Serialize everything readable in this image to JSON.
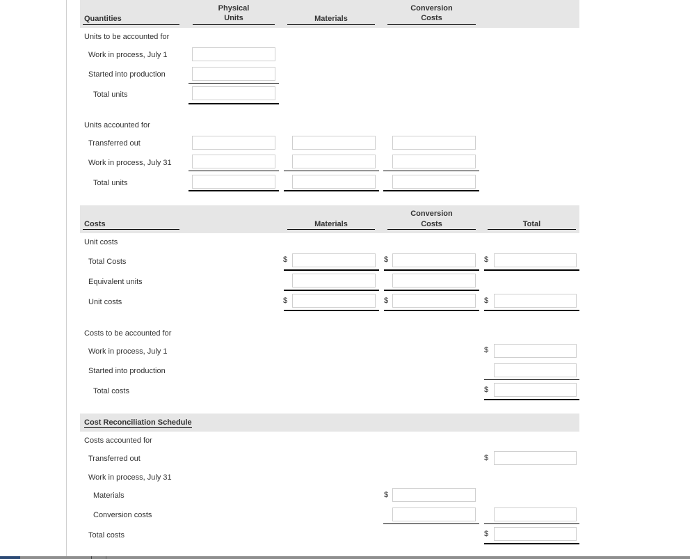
{
  "quantities": {
    "header": {
      "title": "Quantities",
      "col_physical": "Physical\nUnits",
      "col_physical_l1": "Physical",
      "col_physical_l2": "Units",
      "col_materials": "Materials",
      "col_conversion_l1": "Conversion",
      "col_conversion_l2": "Costs"
    },
    "to_be_accounted": {
      "label": "Units to be accounted for",
      "rows": [
        {
          "label": "Work in process, July 1",
          "physical": ""
        },
        {
          "label": "Started into production",
          "physical": ""
        },
        {
          "label": "Total units",
          "physical": ""
        }
      ]
    },
    "accounted": {
      "label": "Units accounted for",
      "rows": [
        {
          "label": "Transferred out",
          "physical": "",
          "materials": "",
          "conversion": ""
        },
        {
          "label": "Work in process, July 31",
          "physical": "",
          "materials": "",
          "conversion": ""
        },
        {
          "label": "Total units",
          "physical": "",
          "materials": "",
          "conversion": ""
        }
      ]
    }
  },
  "costs": {
    "header": {
      "title": "Costs",
      "col_materials": "Materials",
      "col_conversion_l1": "Conversion",
      "col_conversion_l2": "Costs",
      "col_total": "Total"
    },
    "unit_costs": {
      "label": "Unit costs",
      "rows": [
        {
          "label": "Total Costs",
          "materials": "",
          "conversion": "",
          "total": ""
        },
        {
          "label": "Equivalent units",
          "materials": "",
          "conversion": ""
        },
        {
          "label": "Unit costs",
          "materials": "",
          "conversion": "",
          "total": ""
        }
      ]
    },
    "to_be_accounted": {
      "label": "Costs to be accounted for",
      "rows": [
        {
          "label": "Work in process, July 1",
          "total": ""
        },
        {
          "label": "Started into production",
          "total": ""
        },
        {
          "label": "Total costs",
          "total": ""
        }
      ]
    }
  },
  "reconciliation": {
    "title": "Cost Reconciliation Schedule",
    "accounted_label": "Costs accounted for",
    "rows": {
      "transferred_out": {
        "label": "Transferred out",
        "total": ""
      },
      "wip_july31": {
        "label": "Work in process, July 31"
      },
      "materials": {
        "label": "Materials",
        "value": ""
      },
      "conversion": {
        "label": "Conversion costs",
        "value": "",
        "total": ""
      },
      "total_costs": {
        "label": "Total costs",
        "total": ""
      }
    }
  },
  "currency_symbol": "$"
}
